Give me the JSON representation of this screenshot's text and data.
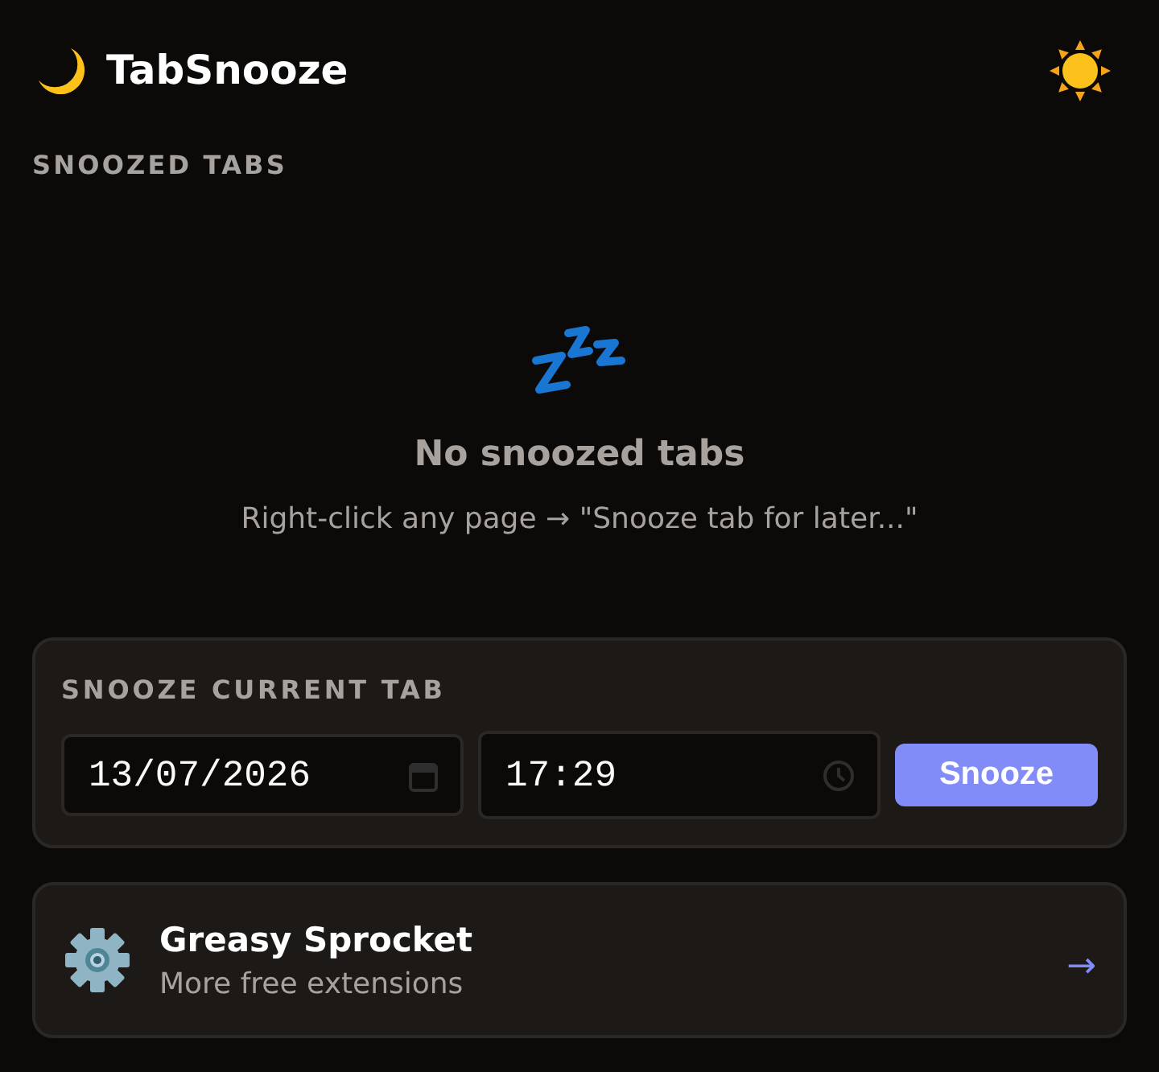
{
  "app": {
    "title": "TabSnooze"
  },
  "snoozed_section": {
    "heading": "SNOOZED TABS",
    "empty_state": {
      "title": "No snoozed tabs",
      "hint": "Right-click any page → \"Snooze tab for later...\""
    }
  },
  "snooze_form": {
    "heading": "SNOOZE CURRENT TAB",
    "date_field": {
      "value": "13/07/2026"
    },
    "time_field": {
      "value": "17:29"
    },
    "button": "Snooze"
  },
  "promo": {
    "title": "Greasy Sprocket",
    "subtitle": "More free extensions",
    "arrow": "→"
  }
}
